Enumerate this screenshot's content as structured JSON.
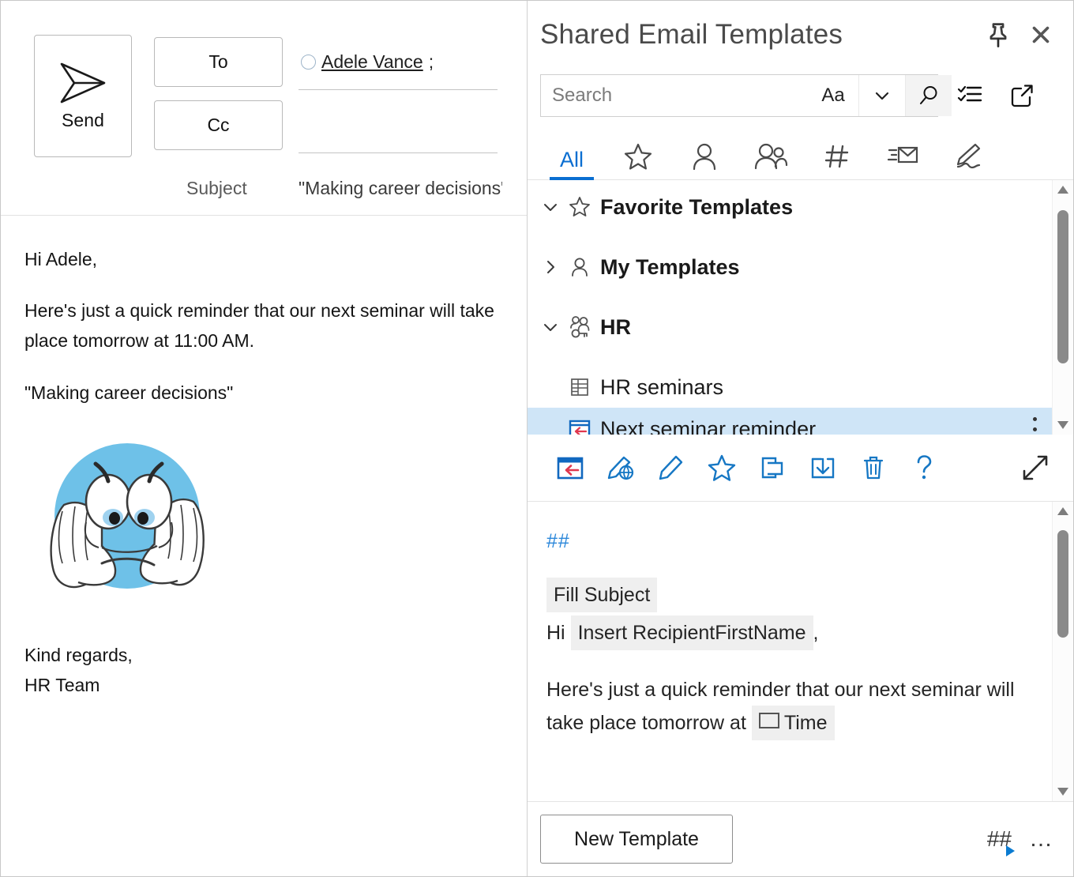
{
  "compose": {
    "send_label": "Send",
    "send_icon": "paper-plane-icon",
    "to_label": "To",
    "cc_label": "Cc",
    "recipient": "Adele Vance",
    "recipient_separator": ";",
    "subject_label": "Subject",
    "subject_value": "\"Making career decisions\"",
    "body": {
      "greeting": "Hi Adele,",
      "paragraph": "Here's just a quick reminder that our next seminar will take place tomorrow at 11:00 AM.",
      "quote": "\"Making career decisions\"",
      "image_alt": "worried-blue-emoji",
      "signoff": "Kind regards,",
      "signature": "HR Team"
    }
  },
  "pane": {
    "title": "Shared Email Templates",
    "pin_icon": "pin-icon",
    "close_icon": "close-icon",
    "search": {
      "placeholder": "Search",
      "value": "",
      "match_case_label": "Aa",
      "chevron_icon": "chevron-down-icon",
      "search_icon": "magnifier-icon"
    },
    "header_actions": [
      {
        "name": "checklist-icon",
        "title": "Checklist"
      },
      {
        "name": "open-external-icon",
        "title": "Open in new window"
      }
    ],
    "tabs": [
      {
        "label": "All",
        "icon": "text-all",
        "active": true
      },
      {
        "label": "",
        "icon": "star-icon",
        "active": false
      },
      {
        "label": "",
        "icon": "person-icon",
        "active": false
      },
      {
        "label": "",
        "icon": "people-icon",
        "active": false
      },
      {
        "label": "",
        "icon": "hashtag-icon",
        "active": false
      },
      {
        "label": "",
        "icon": "mail-rules-icon",
        "active": false
      },
      {
        "label": "",
        "icon": "pen-signature-icon",
        "active": false
      }
    ],
    "tree": [
      {
        "label": "Favorite Templates",
        "icon": "star-icon",
        "chevron": "chevron-down-icon",
        "expanded": true,
        "level": 0,
        "selected": false
      },
      {
        "label": "My Templates",
        "icon": "person-icon",
        "chevron": "chevron-right-icon",
        "expanded": false,
        "level": 0,
        "selected": false
      },
      {
        "label": "HR",
        "icon": "team-key-icon",
        "chevron": "chevron-down-icon",
        "expanded": true,
        "level": 0,
        "selected": false
      },
      {
        "label": "HR seminars",
        "icon": "dataset-icon",
        "chevron": "",
        "expanded": false,
        "level": 1,
        "selected": false
      },
      {
        "label": "Next seminar reminder",
        "icon": "template-insert-icon",
        "chevron": "",
        "expanded": false,
        "level": 1,
        "selected": true,
        "kebab": "more-options-icon"
      }
    ],
    "actions": [
      {
        "name": "insert-template-icon"
      },
      {
        "name": "edit-html-icon"
      },
      {
        "name": "edit-pencil-icon"
      },
      {
        "name": "favorite-star-icon"
      },
      {
        "name": "copy-icon"
      },
      {
        "name": "save-to-icon"
      },
      {
        "name": "delete-trash-icon"
      },
      {
        "name": "help-question-icon"
      },
      {
        "name": "expand-collapse-icon"
      }
    ],
    "preview": {
      "hash_marker": "##",
      "subject_macro": "Fill Subject",
      "greeting_prefix": "Hi",
      "name_macro": "Insert RecipientFirstName",
      "greeting_suffix": ",",
      "paragraph_prefix": "Here's just a quick reminder that our next seminar will take place tomorrow at",
      "time_macro": "Time"
    },
    "footer": {
      "new_template_label": "New Template",
      "hash_play_label": "##",
      "more_label": "…"
    }
  },
  "colors": {
    "accent_blue": "#0a6ed1",
    "icon_blue": "#1677c4",
    "selection_blue": "#cfe5f7",
    "macro_gray": "#efefef",
    "emoji_blue": "#6ec1e8",
    "hash_blue": "#2b87da",
    "red_arrow": "#e0384f"
  }
}
